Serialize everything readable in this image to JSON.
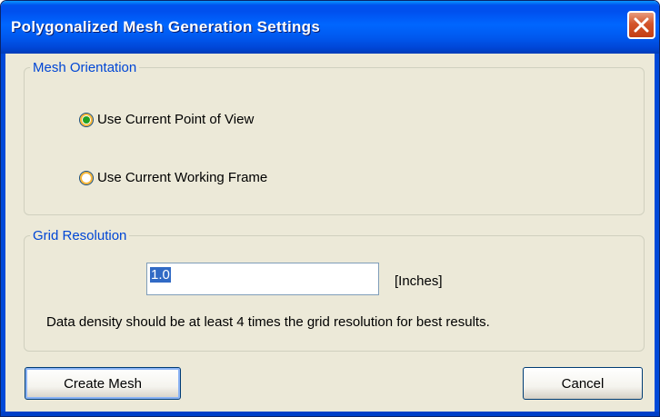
{
  "window": {
    "title": "Polygonalized Mesh Generation Settings"
  },
  "orientation": {
    "legend": "Mesh Orientation",
    "options": [
      {
        "label": "Use Current Point of View",
        "checked": true
      },
      {
        "label": "Use Current Working Frame",
        "checked": false
      }
    ]
  },
  "grid": {
    "legend": "Grid Resolution",
    "value": "1.0",
    "units": "[Inches]",
    "note": "Data density should be at least 4 times the grid resolution for best results."
  },
  "buttons": {
    "create": "Create Mesh",
    "cancel": "Cancel"
  },
  "colors": {
    "titlebar": "#0058EE",
    "legend_text": "#0046D5",
    "radio_checked": "#21A121",
    "dialog_bg": "#ECE9D8",
    "close_button": "#D4542A"
  },
  "icons": {
    "close": "close-x-icon"
  }
}
